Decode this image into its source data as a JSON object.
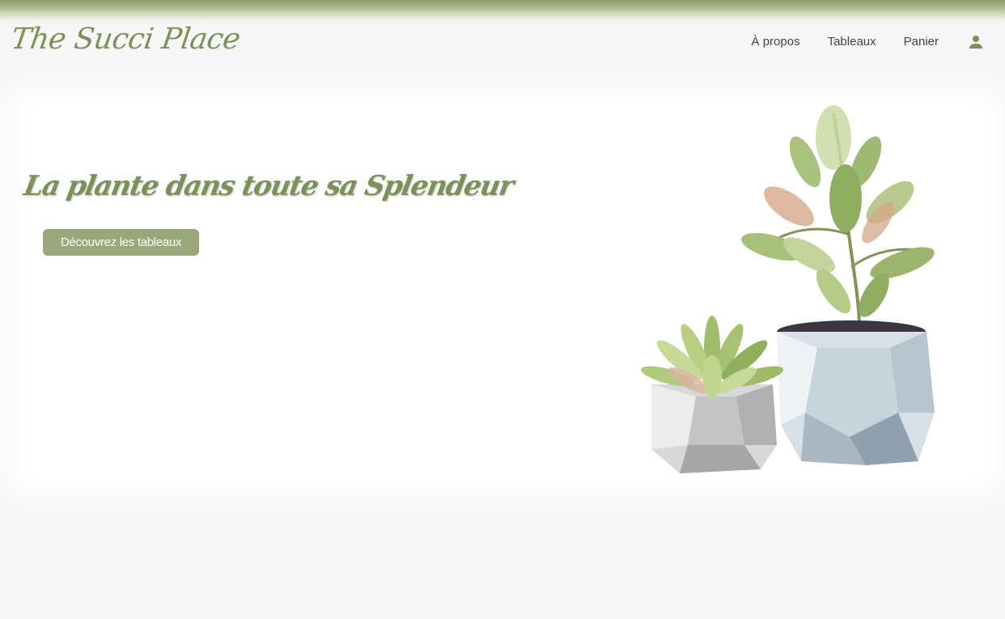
{
  "brand": {
    "logo_text": "The Succi Place",
    "accent": "#7a9158",
    "button_color": "#9aa77a"
  },
  "nav": {
    "items": [
      {
        "label": "À propos"
      },
      {
        "label": "Tableaux"
      },
      {
        "label": "Panier"
      }
    ],
    "account_icon": "user-icon"
  },
  "hero": {
    "title": "La plante dans toute sa Splendeur",
    "cta_label": "Découvrez les tableaux",
    "image": "succulents-in-pots-illustration"
  }
}
